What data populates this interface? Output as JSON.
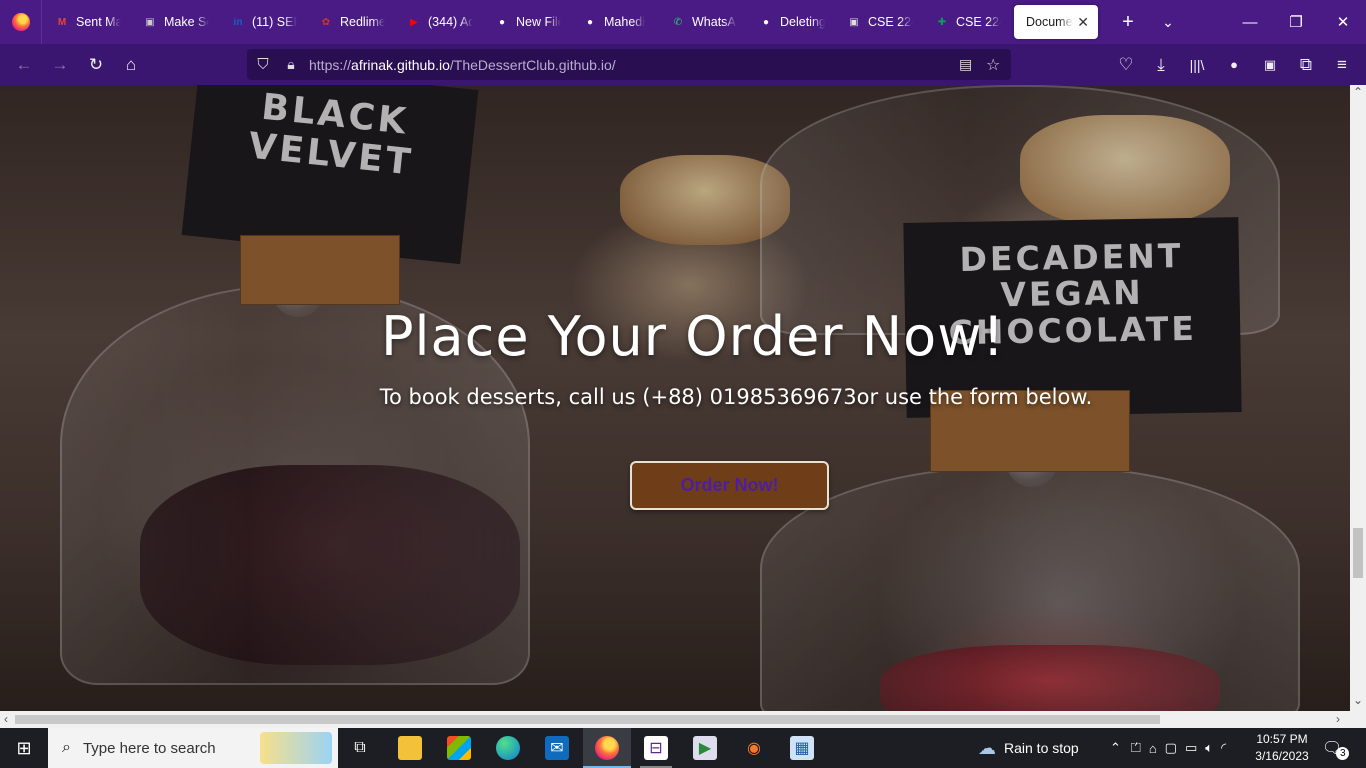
{
  "browser": {
    "tabs": [
      {
        "label": "Sent Mail",
        "icon": "gmail-icon",
        "color": "#ea4335"
      },
      {
        "label": "Make Ser",
        "icon": "app-icon",
        "color": "#cccccc"
      },
      {
        "label": "(11) SEBI",
        "icon": "linkedin-icon",
        "color": "#0a66c2"
      },
      {
        "label": "Redlime",
        "icon": "redlime-icon",
        "color": "#d93025"
      },
      {
        "label": "(344) Ad",
        "icon": "youtube-icon",
        "color": "#ff0000"
      },
      {
        "label": "New File",
        "icon": "github-icon",
        "color": "#ffffff"
      },
      {
        "label": "Mahedi",
        "icon": "github-icon",
        "color": "#ffffff"
      },
      {
        "label": "WhatsAp",
        "icon": "whatsapp-icon",
        "color": "#25d366"
      },
      {
        "label": "Deleting",
        "icon": "github-icon",
        "color": "#ffffff"
      },
      {
        "label": "CSE 224",
        "icon": "classroom-icon",
        "color": "#dddddd"
      },
      {
        "label": "CSE 224",
        "icon": "sheets-icon",
        "color": "#0f9d58"
      },
      {
        "label": "Document",
        "icon": "none",
        "active": true
      }
    ],
    "url": {
      "scheme": "https://",
      "host": "afrinak.github.io",
      "path": "/TheDessertClub.github.io/"
    }
  },
  "page": {
    "hero_title": "Place Your Order Now!",
    "hero_subtitle": "To book desserts, call us (+88) 01985369673or use the form below.",
    "order_button": "Order Now!",
    "sign_left": "BLACK\nVELVET",
    "sign_right": "DECADENT\nVEGAN\nCHOCOLATE"
  },
  "taskbar": {
    "search_placeholder": "Type here to search",
    "weather": "Rain to stop",
    "time": "10:57 PM",
    "date": "3/16/2023",
    "notifications": "3"
  },
  "colors": {
    "tabbar_bg": "#4a1b84",
    "navbar_bg": "#3a1670",
    "button_bg": "#6f3e18",
    "button_text": "#4b1fa0"
  }
}
